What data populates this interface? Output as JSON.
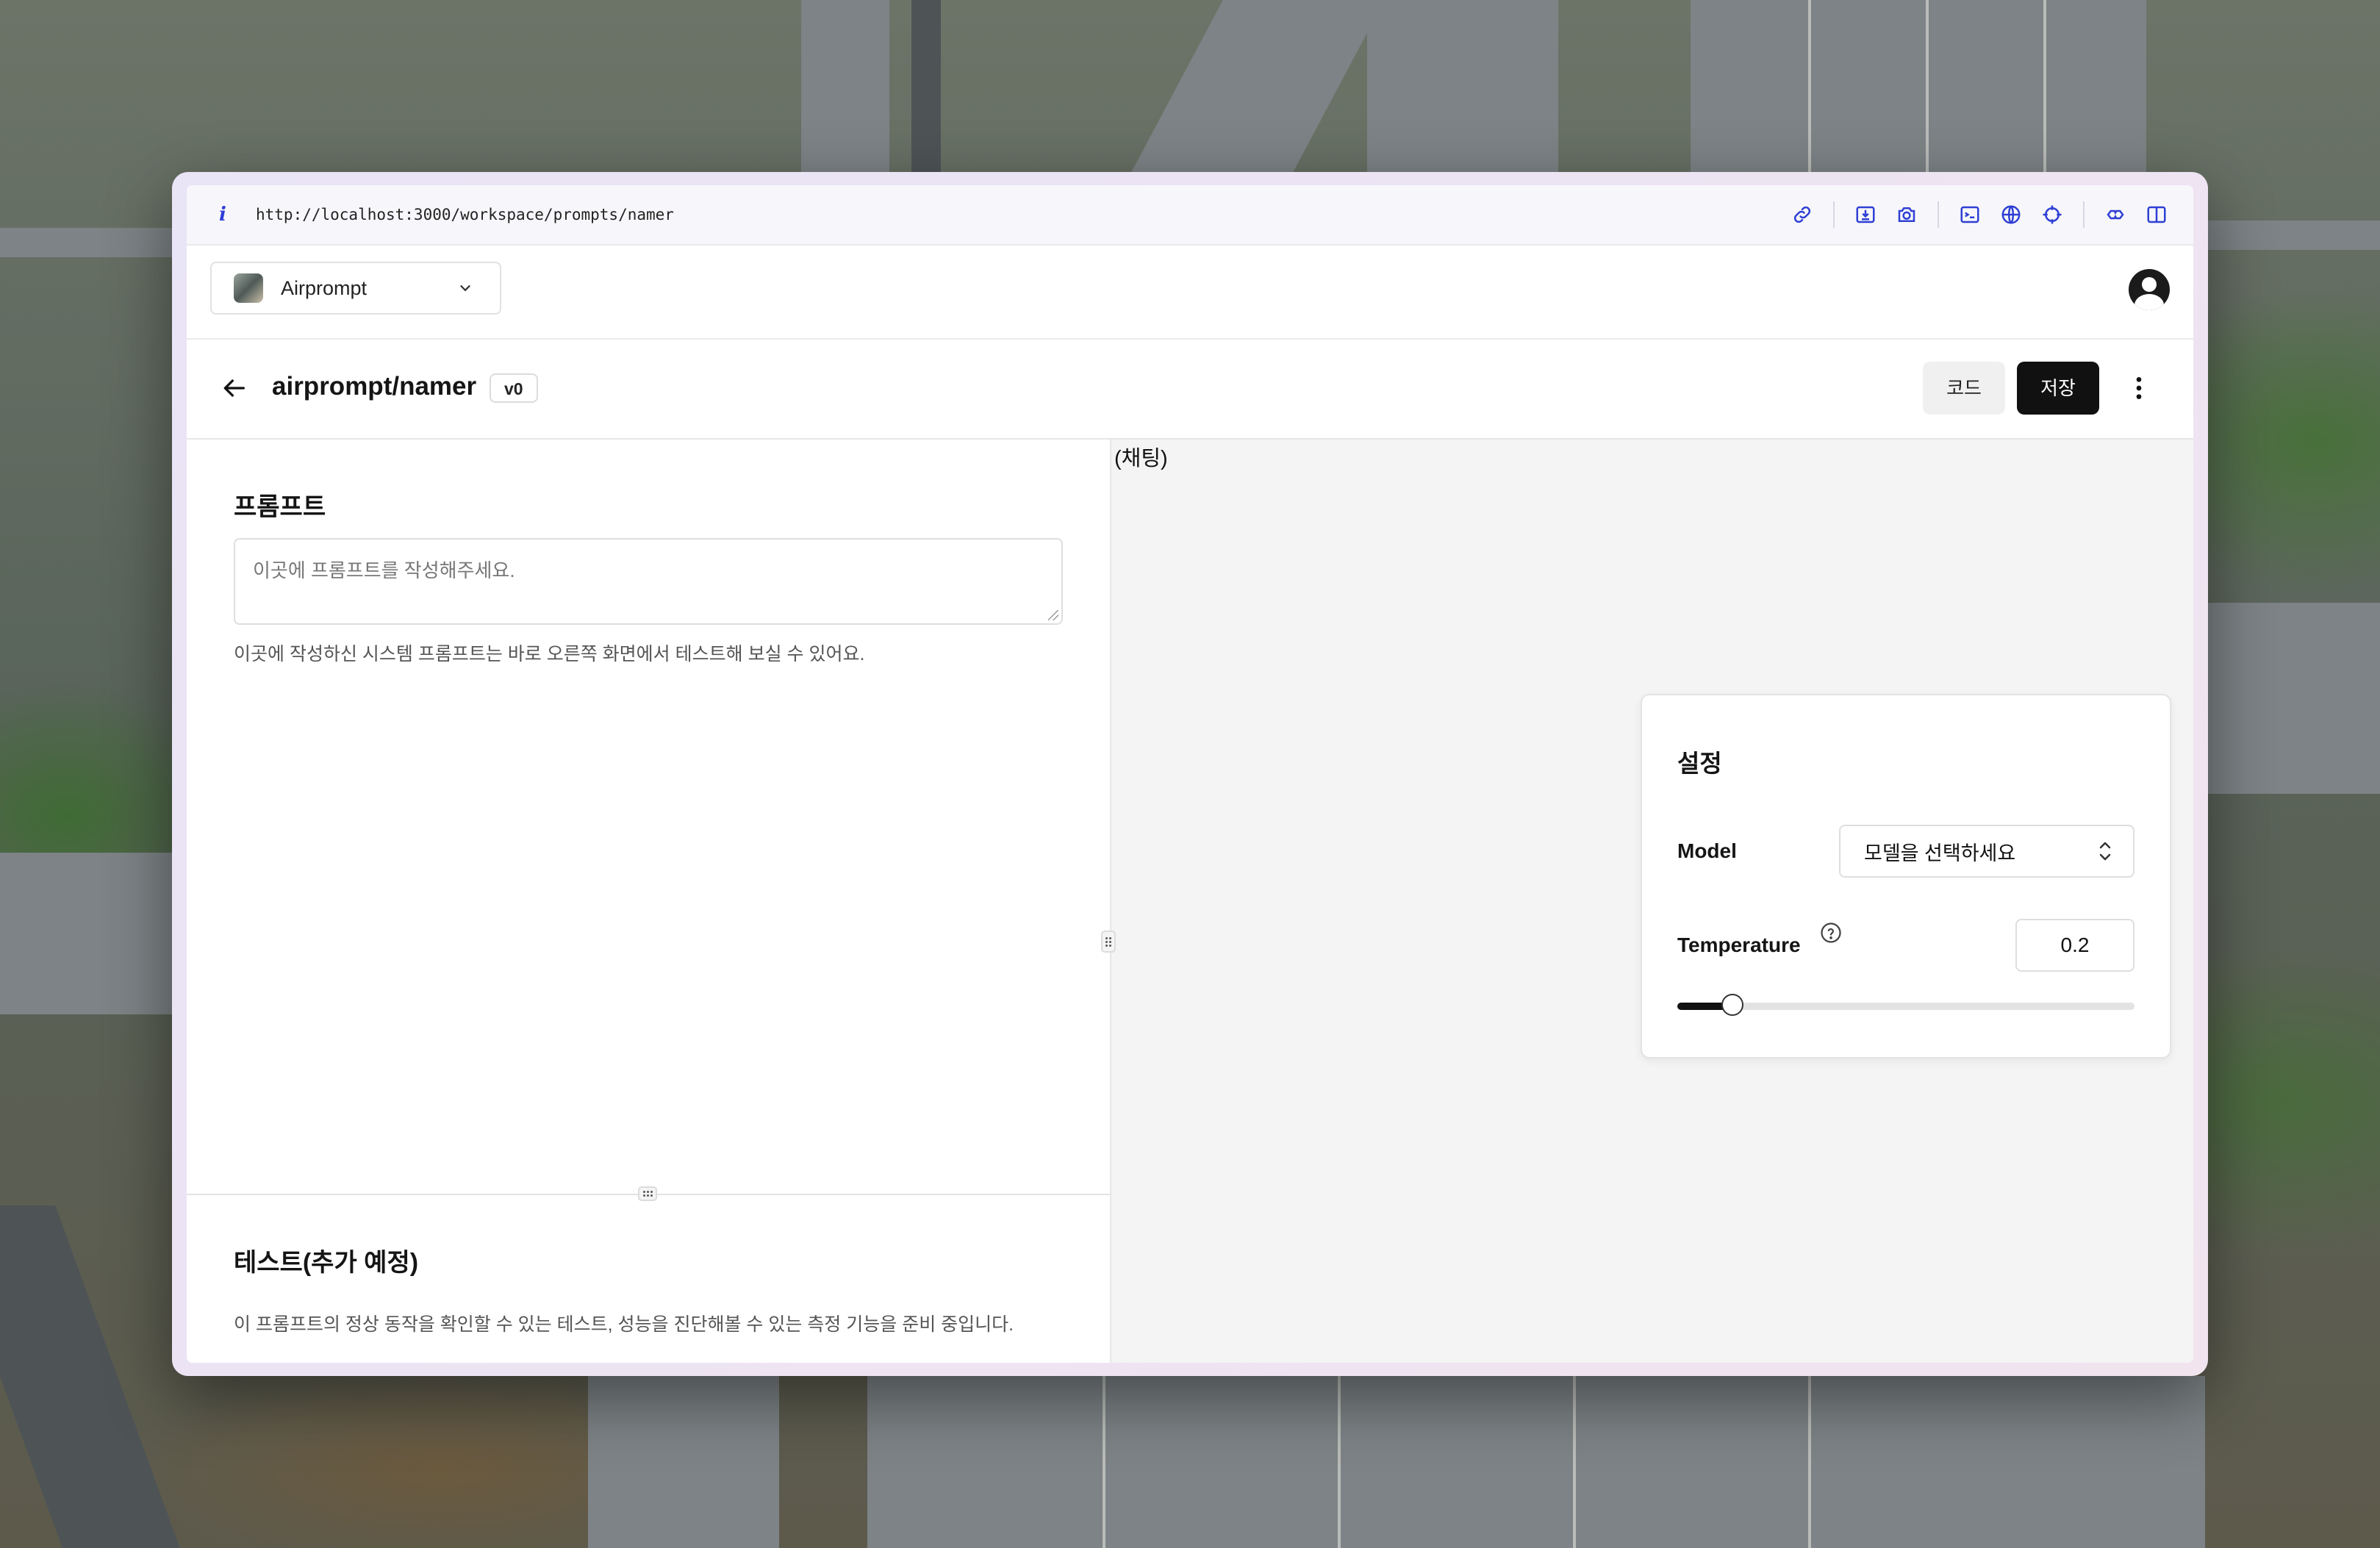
{
  "browser": {
    "url": "http://localhost:3000/workspace/prompts/namer",
    "tools": [
      "link-icon",
      "download-icon",
      "camera-icon",
      "terminal-icon",
      "globe-icon",
      "crosshair-icon",
      "puzzle-icon",
      "split-view-icon"
    ]
  },
  "app": {
    "workspace": {
      "name": "Airprompt"
    }
  },
  "header": {
    "title": "airprompt/namer",
    "version": "v0",
    "code_label": "코드",
    "save_label": "저장"
  },
  "prompt_section": {
    "title": "프롬프트",
    "placeholder": "이곳에 프롬프트를 작성해주세요.",
    "helper": "이곳에 작성하신 시스템 프롬프트는 바로 오른쪽 화면에서 테스트해 보실 수 있어요."
  },
  "test_section": {
    "title": "테스트(추가 예정)",
    "description": "이 프롬프트의 정상 동작을 확인할 수 있는 테스트, 성능을 진단해볼 수 있는 측정 기능을 준비 중입니다."
  },
  "chat": {
    "label": "(채팅)"
  },
  "settings": {
    "title": "설정",
    "model_label": "Model",
    "model_placeholder": "모델을 선택하세요",
    "temperature_label": "Temperature",
    "temperature_value": "0.2",
    "temperature_fraction": 0.12
  },
  "colors": {
    "accent": "#2f3fd4",
    "primary_button": "#111111"
  }
}
